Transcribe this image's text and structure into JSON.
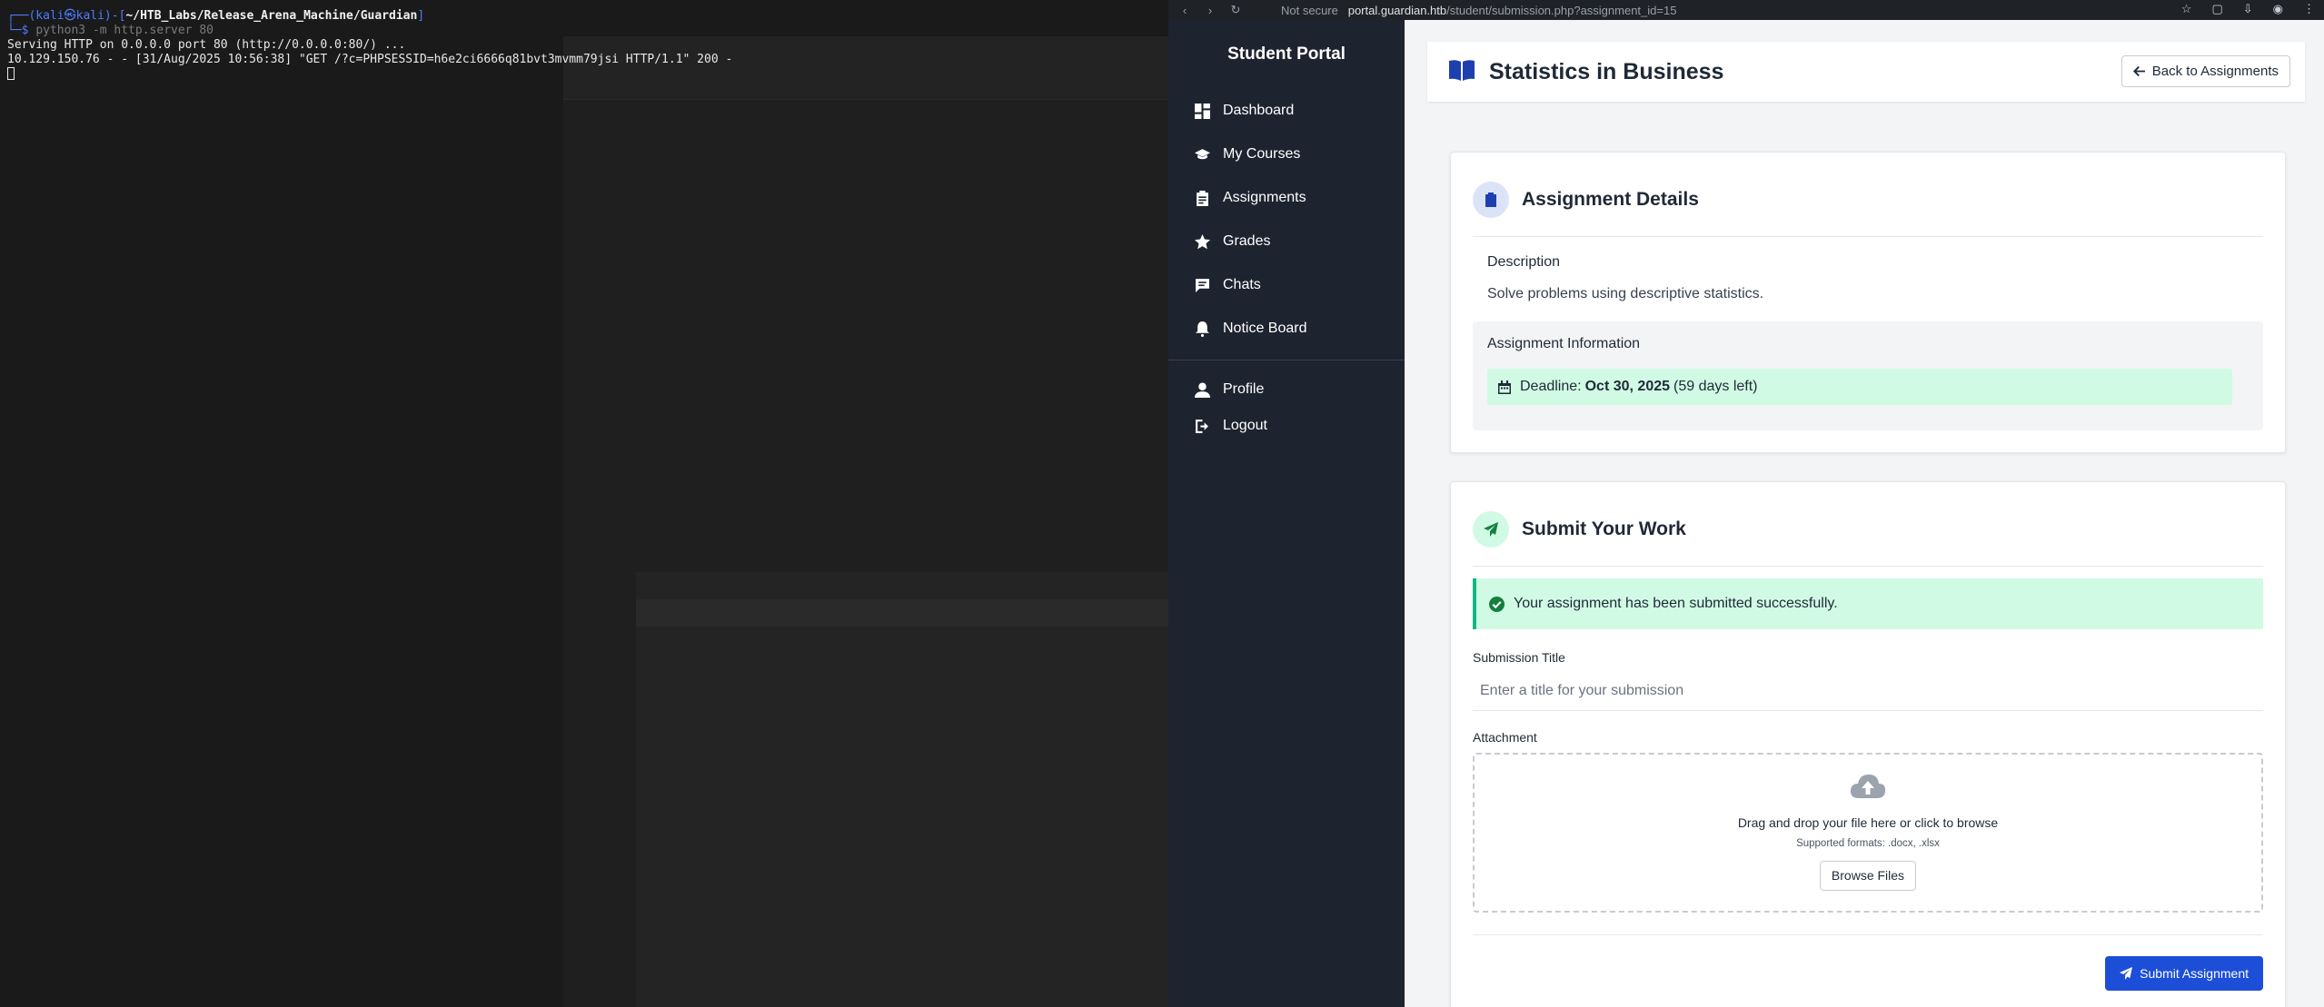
{
  "terminal": {
    "prompt_user": "(kali㉿kali)",
    "prompt_path": "~/HTB_Labs/Release_Arena_Machine/Guardian",
    "command": "python3 -m http.server 80",
    "output_1": "Serving HTTP on 0.0.0.0 port 80 (http://0.0.0.0:80/) ...",
    "output_2": "10.129.150.76 - - [31/Aug/2025 10:56:38] \"GET /?c=PHPSESSID=h6e2ci6666q81bvt3mvmm79jsi HTTP/1.1\" 200 -"
  },
  "browser": {
    "security": "Not secure",
    "url_host": "portal.guardian.htb",
    "url_path": "/student/submission.php?assignment_id=15"
  },
  "sidebar": {
    "brand": "Student Portal",
    "items": [
      {
        "label": "Dashboard",
        "icon": "dashboard-icon"
      },
      {
        "label": "My Courses",
        "icon": "graduation-cap-icon"
      },
      {
        "label": "Assignments",
        "icon": "clipboard-icon"
      },
      {
        "label": "Grades",
        "icon": "star-icon"
      },
      {
        "label": "Chats",
        "icon": "chat-icon"
      },
      {
        "label": "Notice Board",
        "icon": "bell-icon"
      }
    ],
    "bottom_items": [
      {
        "label": "Profile",
        "icon": "user-icon"
      },
      {
        "label": "Logout",
        "icon": "logout-icon"
      }
    ]
  },
  "header": {
    "title": "Statistics in Business",
    "back_label": "Back to Assignments"
  },
  "details": {
    "heading": "Assignment Details",
    "description_label": "Description",
    "description": "Solve problems using descriptive statistics.",
    "info_label": "Assignment Information",
    "deadline_prefix": "Deadline:",
    "deadline_date": "Oct 30, 2025",
    "deadline_left": "(59 days left)"
  },
  "submit": {
    "heading": "Submit Your Work",
    "success_message": "Your assignment has been submitted successfully.",
    "title_label": "Submission Title",
    "title_placeholder": "Enter a title for your submission",
    "attachment_label": "Attachment",
    "drop_text": "Drag and drop your file here or click to browse",
    "formats": "Supported formats: .docx, .xlsx",
    "browse_label": "Browse Files",
    "submit_label": "Submit Assignment"
  },
  "colors": {
    "sidebar_bg": "#1e2330",
    "accent": "#1d4ed8",
    "success_bg": "#d1fae5",
    "success_border": "#10b981"
  }
}
